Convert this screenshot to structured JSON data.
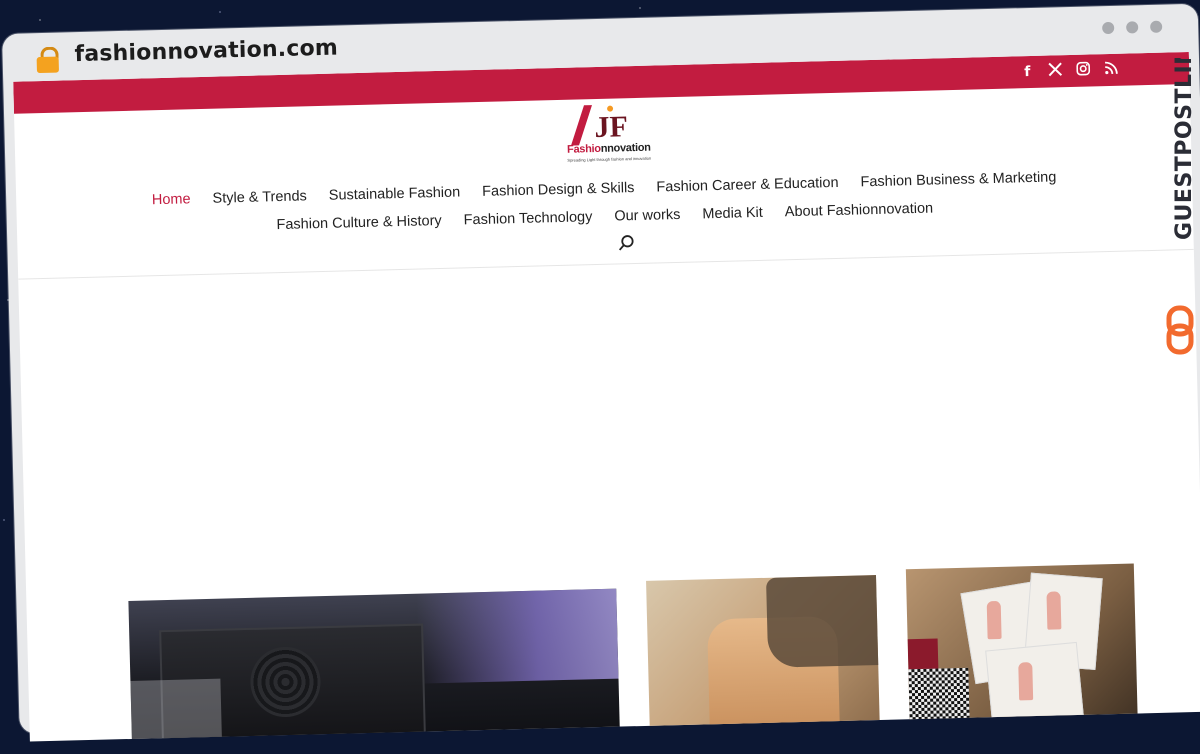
{
  "browser": {
    "url": "fashionnovation.com"
  },
  "social": {
    "facebook": "f",
    "x": "𝕏",
    "instagram": "◎",
    "rss": "RSS"
  },
  "logo": {
    "monogram": "JF",
    "word_part1": "Fashio",
    "word_part2": "nnovation",
    "tagline": "Spreading Light through fashion and innovation"
  },
  "nav": {
    "row1": [
      "Home",
      "Style & Trends",
      "Sustainable Fashion",
      "Fashion Design & Skills",
      "Fashion Career & Education",
      "Fashion Business & Marketing"
    ],
    "row2": [
      "Fashion Culture & History",
      "Fashion Technology",
      "Our works",
      "Media Kit",
      "About Fashionnovation"
    ],
    "active": "Home"
  },
  "watermark": {
    "text": "GUESTPOSTLINKS"
  },
  "colors": {
    "brand": "#c21c40",
    "watermark_orange": "#f26a2e",
    "watermark_dark": "#2b2d36"
  }
}
